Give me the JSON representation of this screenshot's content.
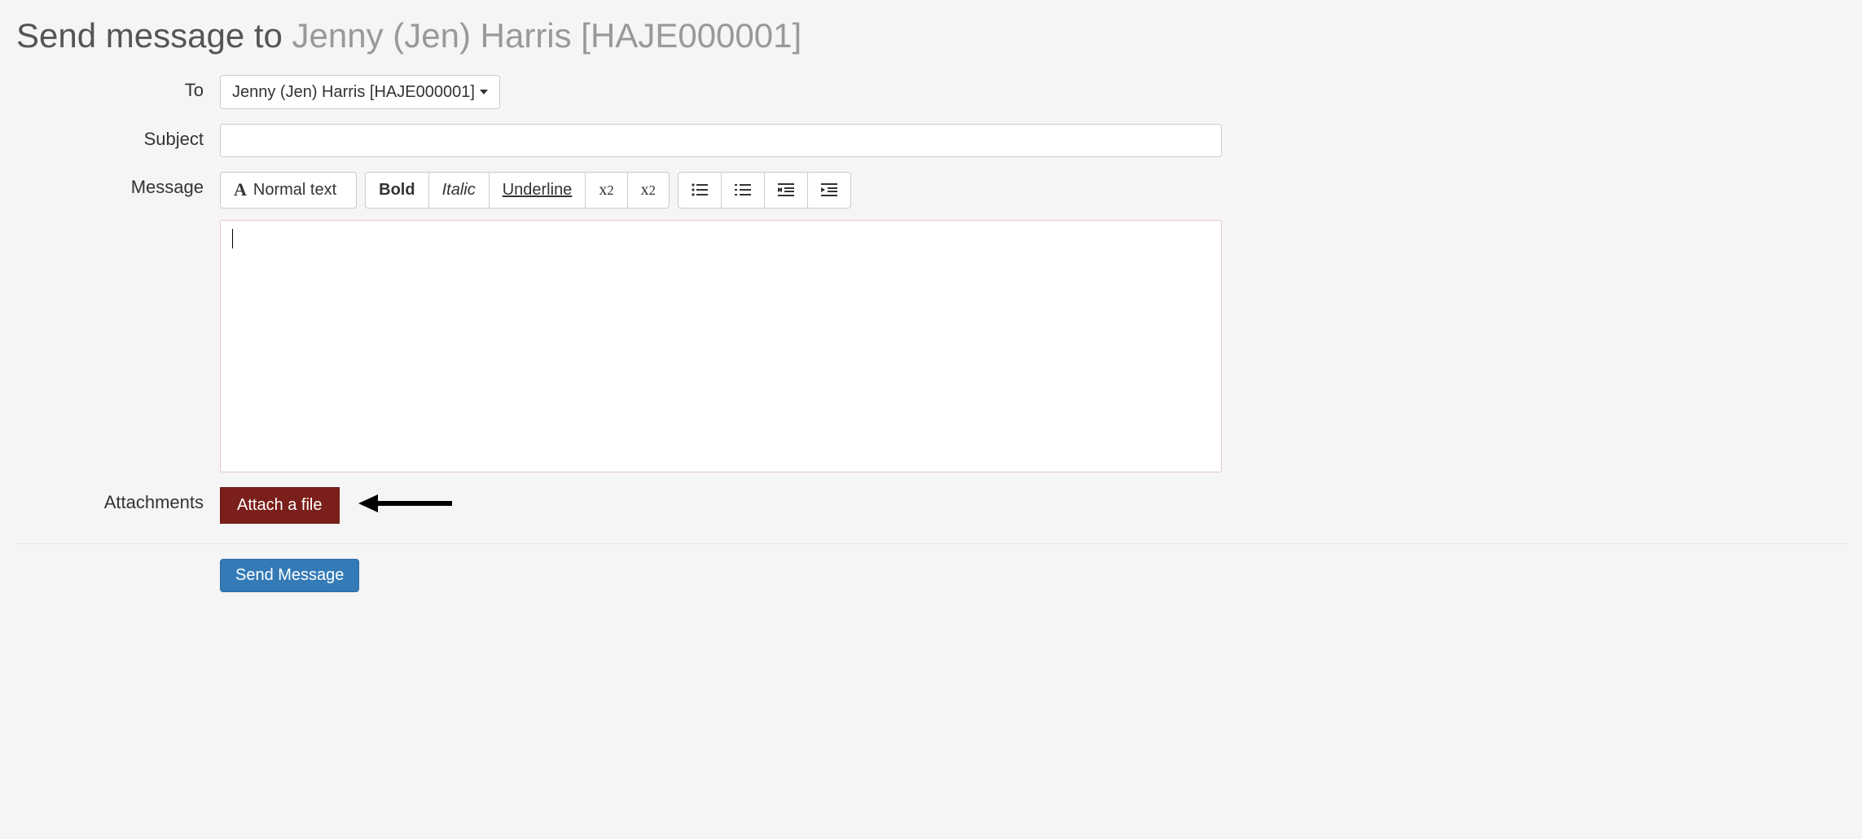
{
  "title": {
    "prefix": "Send message to ",
    "recipient": "Jenny (Jen) Harris [HAJE000001]"
  },
  "labels": {
    "to": "To",
    "subject": "Subject",
    "message": "Message",
    "attachments": "Attachments"
  },
  "to_dropdown": {
    "selected": "Jenny (Jen) Harris [HAJE000001]"
  },
  "subject_value": "",
  "message_value": "",
  "toolbar": {
    "text_style": "Normal text",
    "bold": "Bold",
    "italic": "Italic",
    "underline": "Underline",
    "subscript": "x",
    "subscript_sub": "2",
    "superscript": "x",
    "superscript_sup": "2"
  },
  "buttons": {
    "attach": "Attach a file",
    "send": "Send Message"
  }
}
